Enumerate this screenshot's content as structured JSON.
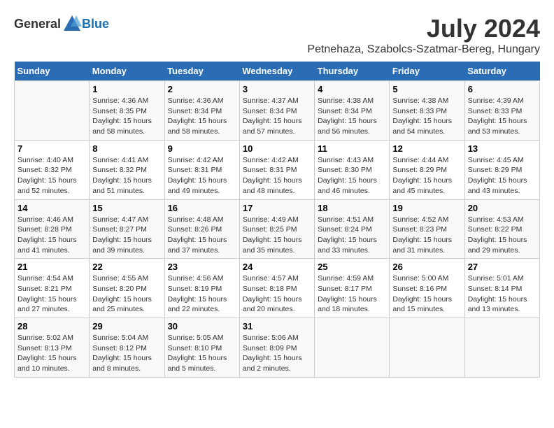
{
  "header": {
    "logo_general": "General",
    "logo_blue": "Blue",
    "month_year": "July 2024",
    "location": "Petnehaza, Szabolcs-Szatmar-Bereg, Hungary"
  },
  "weekdays": [
    "Sunday",
    "Monday",
    "Tuesday",
    "Wednesday",
    "Thursday",
    "Friday",
    "Saturday"
  ],
  "weeks": [
    [
      {
        "day": "",
        "info": ""
      },
      {
        "day": "1",
        "info": "Sunrise: 4:36 AM\nSunset: 8:35 PM\nDaylight: 15 hours\nand 58 minutes."
      },
      {
        "day": "2",
        "info": "Sunrise: 4:36 AM\nSunset: 8:34 PM\nDaylight: 15 hours\nand 58 minutes."
      },
      {
        "day": "3",
        "info": "Sunrise: 4:37 AM\nSunset: 8:34 PM\nDaylight: 15 hours\nand 57 minutes."
      },
      {
        "day": "4",
        "info": "Sunrise: 4:38 AM\nSunset: 8:34 PM\nDaylight: 15 hours\nand 56 minutes."
      },
      {
        "day": "5",
        "info": "Sunrise: 4:38 AM\nSunset: 8:33 PM\nDaylight: 15 hours\nand 54 minutes."
      },
      {
        "day": "6",
        "info": "Sunrise: 4:39 AM\nSunset: 8:33 PM\nDaylight: 15 hours\nand 53 minutes."
      }
    ],
    [
      {
        "day": "7",
        "info": "Sunrise: 4:40 AM\nSunset: 8:32 PM\nDaylight: 15 hours\nand 52 minutes."
      },
      {
        "day": "8",
        "info": "Sunrise: 4:41 AM\nSunset: 8:32 PM\nDaylight: 15 hours\nand 51 minutes."
      },
      {
        "day": "9",
        "info": "Sunrise: 4:42 AM\nSunset: 8:31 PM\nDaylight: 15 hours\nand 49 minutes."
      },
      {
        "day": "10",
        "info": "Sunrise: 4:42 AM\nSunset: 8:31 PM\nDaylight: 15 hours\nand 48 minutes."
      },
      {
        "day": "11",
        "info": "Sunrise: 4:43 AM\nSunset: 8:30 PM\nDaylight: 15 hours\nand 46 minutes."
      },
      {
        "day": "12",
        "info": "Sunrise: 4:44 AM\nSunset: 8:29 PM\nDaylight: 15 hours\nand 45 minutes."
      },
      {
        "day": "13",
        "info": "Sunrise: 4:45 AM\nSunset: 8:29 PM\nDaylight: 15 hours\nand 43 minutes."
      }
    ],
    [
      {
        "day": "14",
        "info": "Sunrise: 4:46 AM\nSunset: 8:28 PM\nDaylight: 15 hours\nand 41 minutes."
      },
      {
        "day": "15",
        "info": "Sunrise: 4:47 AM\nSunset: 8:27 PM\nDaylight: 15 hours\nand 39 minutes."
      },
      {
        "day": "16",
        "info": "Sunrise: 4:48 AM\nSunset: 8:26 PM\nDaylight: 15 hours\nand 37 minutes."
      },
      {
        "day": "17",
        "info": "Sunrise: 4:49 AM\nSunset: 8:25 PM\nDaylight: 15 hours\nand 35 minutes."
      },
      {
        "day": "18",
        "info": "Sunrise: 4:51 AM\nSunset: 8:24 PM\nDaylight: 15 hours\nand 33 minutes."
      },
      {
        "day": "19",
        "info": "Sunrise: 4:52 AM\nSunset: 8:23 PM\nDaylight: 15 hours\nand 31 minutes."
      },
      {
        "day": "20",
        "info": "Sunrise: 4:53 AM\nSunset: 8:22 PM\nDaylight: 15 hours\nand 29 minutes."
      }
    ],
    [
      {
        "day": "21",
        "info": "Sunrise: 4:54 AM\nSunset: 8:21 PM\nDaylight: 15 hours\nand 27 minutes."
      },
      {
        "day": "22",
        "info": "Sunrise: 4:55 AM\nSunset: 8:20 PM\nDaylight: 15 hours\nand 25 minutes."
      },
      {
        "day": "23",
        "info": "Sunrise: 4:56 AM\nSunset: 8:19 PM\nDaylight: 15 hours\nand 22 minutes."
      },
      {
        "day": "24",
        "info": "Sunrise: 4:57 AM\nSunset: 8:18 PM\nDaylight: 15 hours\nand 20 minutes."
      },
      {
        "day": "25",
        "info": "Sunrise: 4:59 AM\nSunset: 8:17 PM\nDaylight: 15 hours\nand 18 minutes."
      },
      {
        "day": "26",
        "info": "Sunrise: 5:00 AM\nSunset: 8:16 PM\nDaylight: 15 hours\nand 15 minutes."
      },
      {
        "day": "27",
        "info": "Sunrise: 5:01 AM\nSunset: 8:14 PM\nDaylight: 15 hours\nand 13 minutes."
      }
    ],
    [
      {
        "day": "28",
        "info": "Sunrise: 5:02 AM\nSunset: 8:13 PM\nDaylight: 15 hours\nand 10 minutes."
      },
      {
        "day": "29",
        "info": "Sunrise: 5:04 AM\nSunset: 8:12 PM\nDaylight: 15 hours\nand 8 minutes."
      },
      {
        "day": "30",
        "info": "Sunrise: 5:05 AM\nSunset: 8:10 PM\nDaylight: 15 hours\nand 5 minutes."
      },
      {
        "day": "31",
        "info": "Sunrise: 5:06 AM\nSunset: 8:09 PM\nDaylight: 15 hours\nand 2 minutes."
      },
      {
        "day": "",
        "info": ""
      },
      {
        "day": "",
        "info": ""
      },
      {
        "day": "",
        "info": ""
      }
    ]
  ]
}
